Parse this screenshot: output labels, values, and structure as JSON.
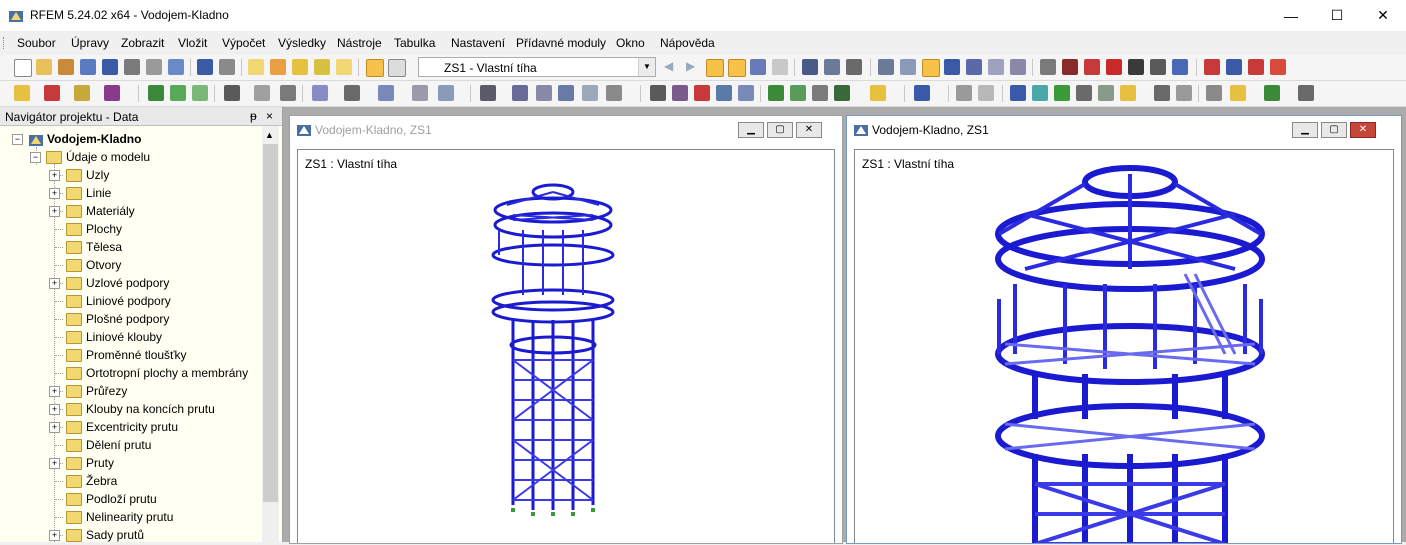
{
  "app": {
    "title": "RFEM 5.24.02 x64 - Vodojem-Kladno",
    "minimize": "—",
    "maximize": "☐",
    "close": "✕"
  },
  "menu": [
    {
      "label": "Soubor"
    },
    {
      "label": "Úpravy"
    },
    {
      "label": "Zobrazit"
    },
    {
      "label": "Vložit"
    },
    {
      "label": "Výpočet"
    },
    {
      "label": "Výsledky"
    },
    {
      "label": "Nástroje"
    },
    {
      "label": "Tabulka"
    },
    {
      "label": "Nastavení"
    },
    {
      "label": "Přídavné moduly"
    },
    {
      "label": "Okno"
    },
    {
      "label": "Nápověda"
    }
  ],
  "toolbar": {
    "load_case": "ZS1 - Vlastní tíha",
    "accent": "#f6c24a"
  },
  "navigator": {
    "title": "Navigátor projektu - Data",
    "pin": "ᵽ",
    "close": "×",
    "project": "Vodojem-Kladno",
    "model_data": "Údaje o modelu",
    "items": [
      {
        "label": "Uzly",
        "expandable": true
      },
      {
        "label": "Linie",
        "expandable": true
      },
      {
        "label": "Materiály",
        "expandable": true
      },
      {
        "label": "Plochy",
        "expandable": false
      },
      {
        "label": "Tělesa",
        "expandable": false
      },
      {
        "label": "Otvory",
        "expandable": false
      },
      {
        "label": "Uzlové podpory",
        "expandable": true
      },
      {
        "label": "Liniové podpory",
        "expandable": false
      },
      {
        "label": "Plošné podpory",
        "expandable": false
      },
      {
        "label": "Liniové klouby",
        "expandable": false
      },
      {
        "label": "Proměnné tloušťky",
        "expandable": false
      },
      {
        "label": "Ortotropní plochy a membrány",
        "expandable": false
      },
      {
        "label": "Průřezy",
        "expandable": true
      },
      {
        "label": "Klouby na koncích prutu",
        "expandable": true
      },
      {
        "label": "Excentricity prutu",
        "expandable": true
      },
      {
        "label": "Dělení prutu",
        "expandable": false
      },
      {
        "label": "Pruty",
        "expandable": true
      },
      {
        "label": "Žebra",
        "expandable": false
      },
      {
        "label": "Podloží prutu",
        "expandable": false
      },
      {
        "label": "Nelinearity prutu",
        "expandable": false
      },
      {
        "label": "Sady prutů",
        "expandable": true
      }
    ]
  },
  "windows": [
    {
      "title": "Vodojem-Kladno, ZS1",
      "active": false,
      "load_case_label": "ZS1 : Vlastní tíha"
    },
    {
      "title": "Vodojem-Kladno, ZS1",
      "active": true,
      "load_case_label": "ZS1 : Vlastní tíha"
    }
  ],
  "colors": {
    "structure": "#1a1ad0",
    "structure_light": "#7a7af0",
    "mdi_background": "#ababab",
    "close_red": "#c7463a"
  }
}
